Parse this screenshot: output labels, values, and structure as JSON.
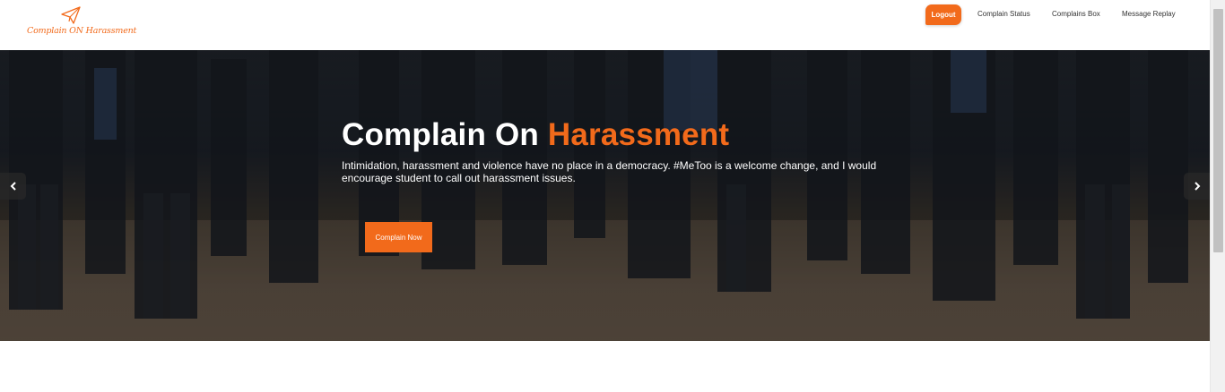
{
  "brand": {
    "logo_icon": "paper-plane-icon",
    "name": "Complain ON Harassment",
    "color": "#f26a1b"
  },
  "nav": {
    "logout_label": "Logout",
    "items": [
      {
        "label": "Complain Status"
      },
      {
        "label": "Complains Box"
      },
      {
        "label": "Message Replay"
      }
    ]
  },
  "hero": {
    "title_main": "Complain On ",
    "title_accent": "Harassment",
    "description": "Intimidation, harassment and violence have no place in a democracy. #MeToo is a welcome change, and I would encourage student to call out harassment issues.",
    "cta_label": "Complain Now",
    "prev_icon": "chevron-left-icon",
    "next_icon": "chevron-right-icon"
  }
}
